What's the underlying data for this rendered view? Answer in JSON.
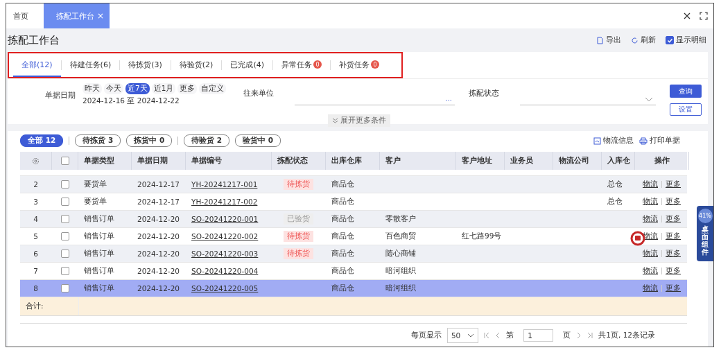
{
  "top_tabs": [
    {
      "label": "首页",
      "selected": false
    },
    {
      "label": "拣配工作台",
      "selected": true,
      "close": "×"
    }
  ],
  "page_title": "拣配工作台",
  "toolbar": {
    "export": "导出",
    "refresh": "刷新",
    "show_detail": {
      "label": "显示明细",
      "checked": true
    }
  },
  "status_tabs": [
    {
      "label": "全部(12)",
      "selected": true
    },
    {
      "label": "待建任务(6)",
      "selected": false
    },
    {
      "label": "待拣货(3)",
      "selected": false
    },
    {
      "label": "待验货(2)",
      "selected": false
    },
    {
      "label": "已完成(4)",
      "selected": false
    },
    {
      "label": "异常任务",
      "badge": "0",
      "selected": false
    },
    {
      "label": "补货任务",
      "badge": "0",
      "selected": false
    }
  ],
  "filters": {
    "date_label": "单据日期",
    "date_chips": [
      {
        "label": "昨天",
        "selected": false
      },
      {
        "label": "今天",
        "selected": false
      },
      {
        "label": "近7天",
        "selected": true
      },
      {
        "label": "近1月",
        "selected": false
      },
      {
        "label": "更多",
        "selected": false
      },
      {
        "label": "自定义",
        "selected": false
      }
    ],
    "date_range": "2024-12-16 至 2024-12-22",
    "partner_label": "往来单位",
    "partner_more": "···",
    "status_label": "拣配状态",
    "expand": "展开更多条件",
    "query": "查询",
    "settings": "设置"
  },
  "quick_filters": [
    {
      "label": "全部 12",
      "selected": true
    },
    {
      "label": "待拣货 3",
      "selected": false
    },
    {
      "label": "拣货中 0",
      "selected": false
    },
    {
      "label": "待验货 2",
      "selected": false
    },
    {
      "label": "验货中 0",
      "selected": false
    }
  ],
  "table_actions": {
    "logistics_info": "物流信息",
    "print": "打印单据"
  },
  "table": {
    "select_all_checked": false,
    "columns": [
      "单据类型",
      "单据日期",
      "单据编号",
      "拣配状态",
      "出库仓库",
      "客户",
      "客户地址",
      "业务员",
      "物流公司",
      "入库仓",
      "操作"
    ],
    "rows": [
      {
        "index": "2",
        "checked": false,
        "selected": false,
        "type": "要货单",
        "date": "2024-12-17",
        "number": "YH-20241217-001",
        "status": {
          "label": "待拣货",
          "kind": "pending"
        },
        "warehouse": "商品仓",
        "customer": "",
        "address": "",
        "inbound": "总仓",
        "actions": [
          "物流",
          "更多"
        ]
      },
      {
        "index": "3",
        "checked": false,
        "selected": false,
        "type": "要货单",
        "date": "2024-12-17",
        "number": "YH-20241217-002",
        "status": null,
        "warehouse": "商品仓",
        "customer": "",
        "address": "",
        "inbound": "总仓",
        "actions": [
          "物流",
          "更多"
        ]
      },
      {
        "index": "4",
        "checked": false,
        "selected": false,
        "type": "销售订单",
        "date": "2024-12-20",
        "number": "SO-20241220-001",
        "status": {
          "label": "已验货",
          "kind": "done"
        },
        "warehouse": "商品仓",
        "customer": "零散客户",
        "address": "",
        "inbound": "",
        "actions": [
          "物流",
          "更多"
        ]
      },
      {
        "index": "5",
        "checked": false,
        "selected": false,
        "type": "销售订单",
        "date": "2024-12-20",
        "number": "SO-20241220-002",
        "status": {
          "label": "待拣货",
          "kind": "pending"
        },
        "warehouse": "商品仓",
        "customer": "百色商贸",
        "address": "红七路99号",
        "inbound": "",
        "actions": [
          "物流",
          "更多"
        ]
      },
      {
        "index": "6",
        "checked": false,
        "selected": false,
        "type": "销售订单",
        "date": "2024-12-20",
        "number": "SO-20241220-003",
        "status": {
          "label": "待拣货",
          "kind": "pending"
        },
        "warehouse": "商品仓",
        "customer": "随心商铺",
        "address": "",
        "inbound": "",
        "actions": [
          "物流",
          "更多"
        ]
      },
      {
        "index": "7",
        "checked": false,
        "selected": false,
        "type": "销售订单",
        "date": "2024-12-20",
        "number": "SO-20241220-004",
        "status": null,
        "warehouse": "商品仓",
        "customer": "暗河组织",
        "address": "",
        "inbound": "",
        "actions": [
          "物流",
          "更多"
        ]
      },
      {
        "index": "8",
        "checked": false,
        "selected": true,
        "type": "销售订单",
        "date": "2024-12-20",
        "number": "SO-20241220-005",
        "status": null,
        "warehouse": "商品仓",
        "customer": "暗河组织",
        "address": "",
        "inbound": "",
        "actions": [
          "物流",
          "更多"
        ]
      }
    ],
    "total_label": "合计:"
  },
  "pagination": {
    "per_page_label": "每页显示",
    "per_page": "50",
    "page_prefix": "第",
    "page": "1",
    "page_suffix": "页",
    "summary": "共1页, 12条记录"
  },
  "widget": {
    "percent": "41%",
    "label": "桌面组件"
  }
}
